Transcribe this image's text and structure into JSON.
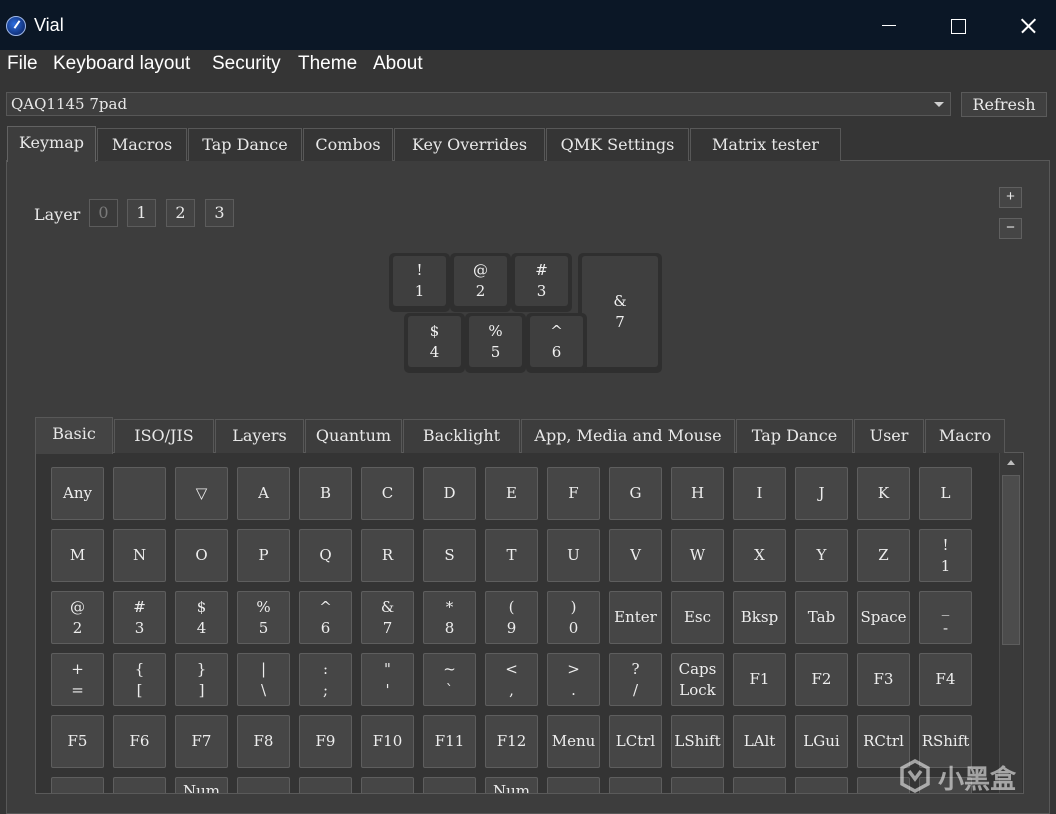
{
  "window": {
    "title": "Vial"
  },
  "menu": [
    "File",
    "Keyboard layout",
    "Security",
    "Theme",
    "About"
  ],
  "device": {
    "selected": "QAQ1145 7pad",
    "refresh_label": "Refresh"
  },
  "main_tabs": [
    "Keymap",
    "Macros",
    "Tap Dance",
    "Combos",
    "Key Overrides",
    "QMK Settings",
    "Matrix tester"
  ],
  "main_tab_active": "Keymap",
  "layers": {
    "label": "Layer",
    "items": [
      "0",
      "1",
      "2",
      "3"
    ],
    "active": "0",
    "add_label": "+",
    "remove_label": "−"
  },
  "keyboard_preview": [
    {
      "top": "!",
      "bottom": "1"
    },
    {
      "top": "@",
      "bottom": "2"
    },
    {
      "top": "#",
      "bottom": "3"
    },
    {
      "top": "&",
      "bottom": "7"
    },
    {
      "top": "$",
      "bottom": "4"
    },
    {
      "top": "%",
      "bottom": "5"
    },
    {
      "top": "^",
      "bottom": "6"
    }
  ],
  "keycode_tabs": [
    "Basic",
    "ISO/JIS",
    "Layers",
    "Quantum",
    "Backlight",
    "App, Media and Mouse",
    "Tap Dance",
    "User",
    "Macro"
  ],
  "keycode_tab_active": "Basic",
  "keycodes": [
    [
      [
        "Any"
      ],
      [
        ""
      ],
      [
        "▽"
      ],
      [
        "A"
      ],
      [
        "B"
      ],
      [
        "C"
      ],
      [
        "D"
      ],
      [
        "E"
      ],
      [
        "F"
      ],
      [
        "G"
      ],
      [
        "H"
      ],
      [
        "I"
      ],
      [
        "J"
      ],
      [
        "K"
      ],
      [
        "L"
      ]
    ],
    [
      [
        "M"
      ],
      [
        "N"
      ],
      [
        "O"
      ],
      [
        "P"
      ],
      [
        "Q"
      ],
      [
        "R"
      ],
      [
        "S"
      ],
      [
        "T"
      ],
      [
        "U"
      ],
      [
        "V"
      ],
      [
        "W"
      ],
      [
        "X"
      ],
      [
        "Y"
      ],
      [
        "Z"
      ],
      [
        "!",
        "1"
      ]
    ],
    [
      [
        "@",
        "2"
      ],
      [
        "#",
        "3"
      ],
      [
        "$",
        "4"
      ],
      [
        "%",
        "5"
      ],
      [
        "^",
        "6"
      ],
      [
        "&",
        "7"
      ],
      [
        "*",
        "8"
      ],
      [
        "(",
        "9"
      ],
      [
        ")",
        "0"
      ],
      [
        "Enter"
      ],
      [
        "Esc"
      ],
      [
        "Bksp"
      ],
      [
        "Tab"
      ],
      [
        "Space"
      ],
      [
        "_",
        "-"
      ]
    ],
    [
      [
        "+",
        "="
      ],
      [
        "{",
        "["
      ],
      [
        "}",
        "]"
      ],
      [
        "|",
        "\\"
      ],
      [
        ":",
        ";"
      ],
      [
        "\"",
        "'"
      ],
      [
        "~",
        "`"
      ],
      [
        "<",
        ","
      ],
      [
        ">",
        "."
      ],
      [
        "?",
        "/"
      ],
      [
        "Caps",
        "Lock"
      ],
      [
        "F1"
      ],
      [
        "F2"
      ],
      [
        "F3"
      ],
      [
        "F4"
      ]
    ],
    [
      [
        "F5"
      ],
      [
        "F6"
      ],
      [
        "F7"
      ],
      [
        "F8"
      ],
      [
        "F9"
      ],
      [
        "F10"
      ],
      [
        "F11"
      ],
      [
        "F12"
      ],
      [
        "Menu"
      ],
      [
        "LCtrl"
      ],
      [
        "LShift"
      ],
      [
        "LAlt"
      ],
      [
        "LGui"
      ],
      [
        "RCtrl"
      ],
      [
        "RShift"
      ]
    ],
    [
      [
        ""
      ],
      [
        ""
      ],
      [
        "Num"
      ],
      [
        ""
      ],
      [
        ""
      ],
      [
        ""
      ],
      [
        ""
      ],
      [
        "Num"
      ],
      [
        ""
      ],
      [
        ""
      ],
      [
        ""
      ],
      [
        ""
      ],
      [
        ""
      ],
      [
        ""
      ],
      [
        ""
      ]
    ]
  ],
  "watermark": {
    "text": "小黑盒"
  }
}
